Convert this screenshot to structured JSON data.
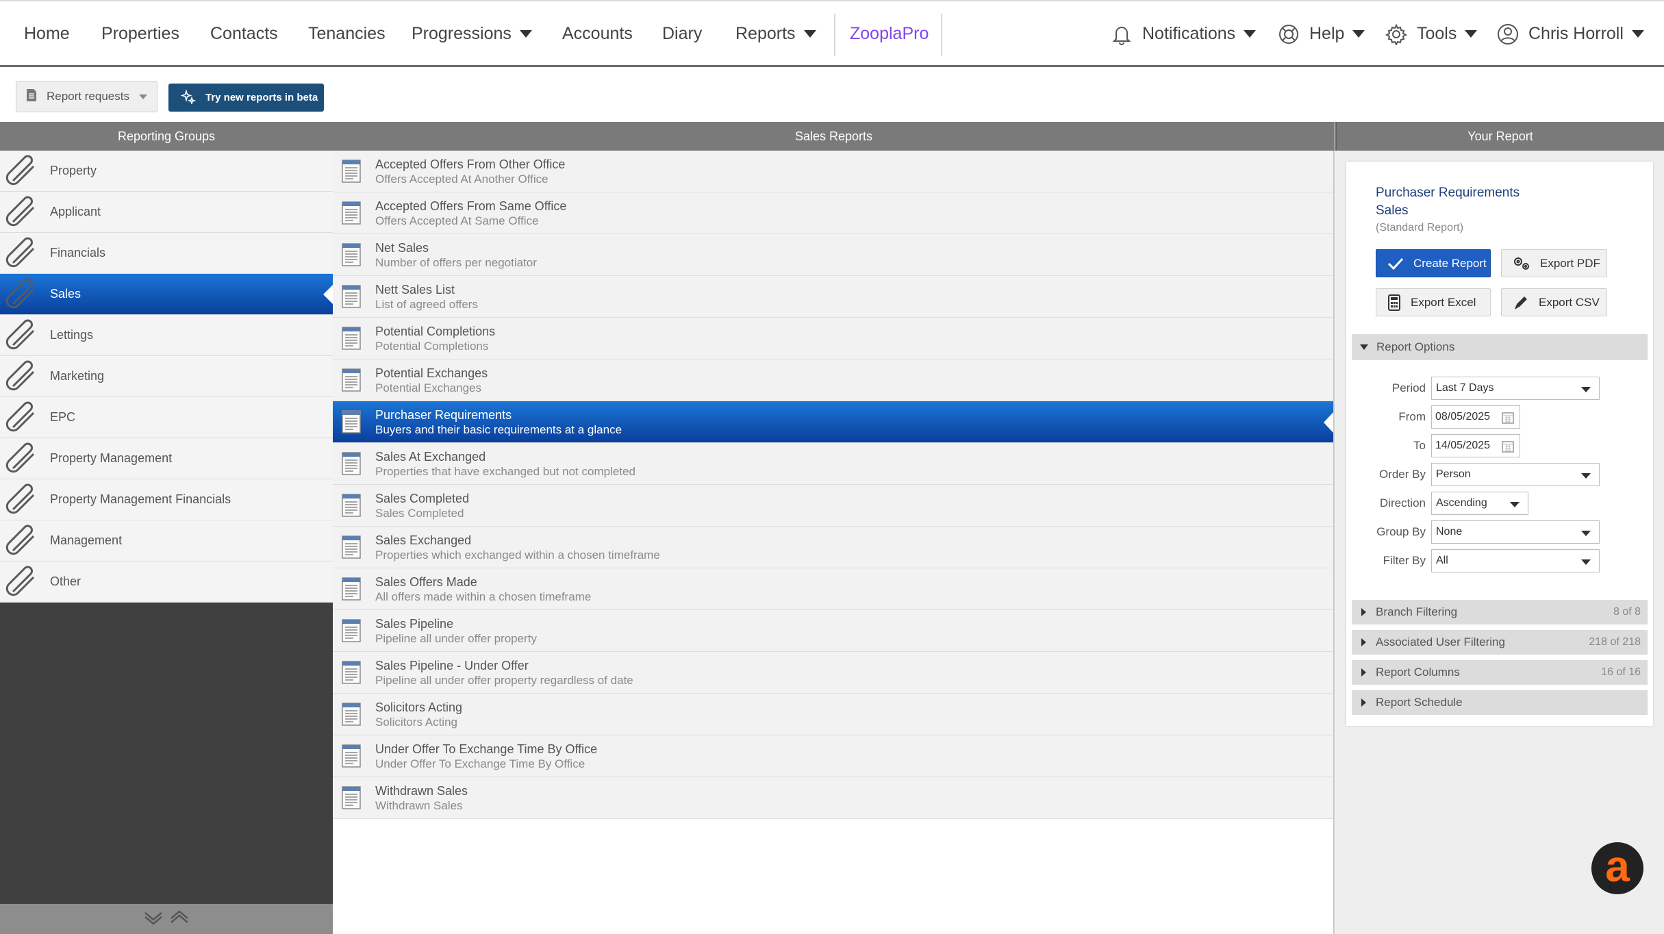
{
  "nav": {
    "home": "Home",
    "properties": "Properties",
    "contacts": "Contacts",
    "tenancies": "Tenancies",
    "progressions": "Progressions",
    "accounts": "Accounts",
    "diary": "Diary",
    "reports": "Reports",
    "zoopla": "ZooplaPro",
    "notifications": "Notifications",
    "help": "Help",
    "tools": "Tools",
    "user": "Chris Horroll"
  },
  "toolbar": {
    "report_requests": "Report requests",
    "beta": "Try new reports in beta"
  },
  "headers": {
    "groups": "Reporting Groups",
    "reports": "Sales Reports",
    "your_report": "Your Report"
  },
  "groups": [
    {
      "label": "Property"
    },
    {
      "label": "Applicant"
    },
    {
      "label": "Financials"
    },
    {
      "label": "Sales"
    },
    {
      "label": "Lettings"
    },
    {
      "label": "Marketing"
    },
    {
      "label": "EPC"
    },
    {
      "label": "Property Management"
    },
    {
      "label": "Property Management Financials"
    },
    {
      "label": "Management"
    },
    {
      "label": "Other"
    }
  ],
  "reports": [
    {
      "title": "Accepted Offers From Other Office",
      "desc": "Offers Accepted At Another Office"
    },
    {
      "title": "Accepted Offers From Same Office",
      "desc": "Offers Accepted At Same Office"
    },
    {
      "title": "Net Sales",
      "desc": "Number of offers per negotiator"
    },
    {
      "title": "Nett Sales List",
      "desc": "List of agreed offers"
    },
    {
      "title": "Potential Completions",
      "desc": "Potential Completions"
    },
    {
      "title": "Potential Exchanges",
      "desc": "Potential Exchanges"
    },
    {
      "title": "Purchaser Requirements",
      "desc": "Buyers and their basic requirements at a glance"
    },
    {
      "title": "Sales At Exchanged",
      "desc": "Properties that have exchanged but not completed"
    },
    {
      "title": "Sales Completed",
      "desc": "Sales Completed"
    },
    {
      "title": "Sales Exchanged",
      "desc": "Properties which exchanged within a chosen timeframe"
    },
    {
      "title": "Sales Offers Made",
      "desc": "All offers made within a chosen timeframe"
    },
    {
      "title": "Sales Pipeline",
      "desc": "Pipeline all under offer property"
    },
    {
      "title": "Sales Pipeline - Under Offer",
      "desc": "Pipeline all under offer property regardless of date"
    },
    {
      "title": "Solicitors Acting",
      "desc": "Solicitors Acting"
    },
    {
      "title": "Under Offer To Exchange Time By Office",
      "desc": "Under Offer To Exchange Time By Office"
    },
    {
      "title": "Withdrawn Sales",
      "desc": "Withdrawn Sales"
    }
  ],
  "your_report": {
    "title_line1": "Purchaser Requirements",
    "title_line2": "Sales",
    "subtitle": "(Standard Report)",
    "create": "Create Report",
    "export_pdf": "Export PDF",
    "export_excel": "Export Excel",
    "export_csv": "Export CSV",
    "report_options": "Report Options",
    "options": {
      "period_label": "Period",
      "period_value": "Last 7 Days",
      "from_label": "From",
      "from_value": "08/05/2025",
      "to_label": "To",
      "to_value": "14/05/2025",
      "order_label": "Order By",
      "order_value": "Person",
      "direction_label": "Direction",
      "direction_value": "Ascending",
      "group_label": "Group By",
      "group_value": "None",
      "filter_label": "Filter By",
      "filter_value": "All"
    },
    "sections": [
      {
        "label": "Branch Filtering",
        "count": "8 of 8"
      },
      {
        "label": "Associated User Filtering",
        "count": "218 of 218"
      },
      {
        "label": "Report Columns",
        "count": "16 of 16"
      },
      {
        "label": "Report Schedule",
        "count": ""
      }
    ]
  },
  "colors": {
    "active_gradient_top": "#1b75d6",
    "active_gradient_bottom": "#0a3f9c",
    "zoopla": "#8046f1",
    "header_bg": "#7a7a7a",
    "beta_button": "#1c4f7a"
  },
  "logo": {
    "letter": "a"
  }
}
